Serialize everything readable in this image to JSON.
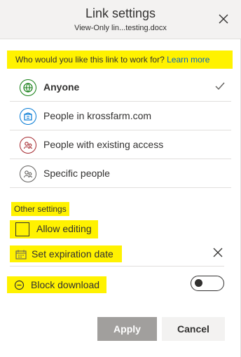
{
  "header": {
    "title": "Link settings",
    "file_name": "View-Only lin...testing.docx"
  },
  "audience": {
    "question": "Who would you like this link to work for?",
    "learn_more": "Learn more",
    "options": [
      {
        "label": "Anyone",
        "icon": "globe-icon",
        "color": "#107c10",
        "selected": true
      },
      {
        "label": "People in krossfarm.com",
        "icon": "building-icon",
        "color": "#0078d4",
        "selected": false
      },
      {
        "label": "People with existing access",
        "icon": "people-icon",
        "color": "#a4262c",
        "selected": false
      },
      {
        "label": "Specific people",
        "icon": "person-icon",
        "color": "#605e5c",
        "selected": false
      }
    ]
  },
  "other_settings": {
    "heading": "Other settings",
    "allow_editing": {
      "label": "Allow editing",
      "checked": false
    },
    "expiration": {
      "label": "Set expiration date"
    },
    "block_download": {
      "label": "Block download",
      "enabled": false
    }
  },
  "buttons": {
    "apply": "Apply",
    "cancel": "Cancel"
  },
  "colors": {
    "highlight": "#fff200",
    "link": "#0a66c2",
    "apply_bg": "#a19f9d"
  }
}
